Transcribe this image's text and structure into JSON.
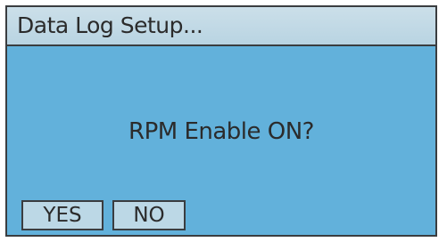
{
  "dialog": {
    "title": "Data Log Setup...",
    "message": "RPM Enable ON?",
    "buttons": {
      "yes_label": "YES",
      "no_label": "NO"
    }
  },
  "colors": {
    "screen_background": "#62b1db",
    "title_bar": "#c6dce8",
    "button_face": "#bcd8e6",
    "border": "#3a3d40",
    "text": "#2b2b2b"
  }
}
